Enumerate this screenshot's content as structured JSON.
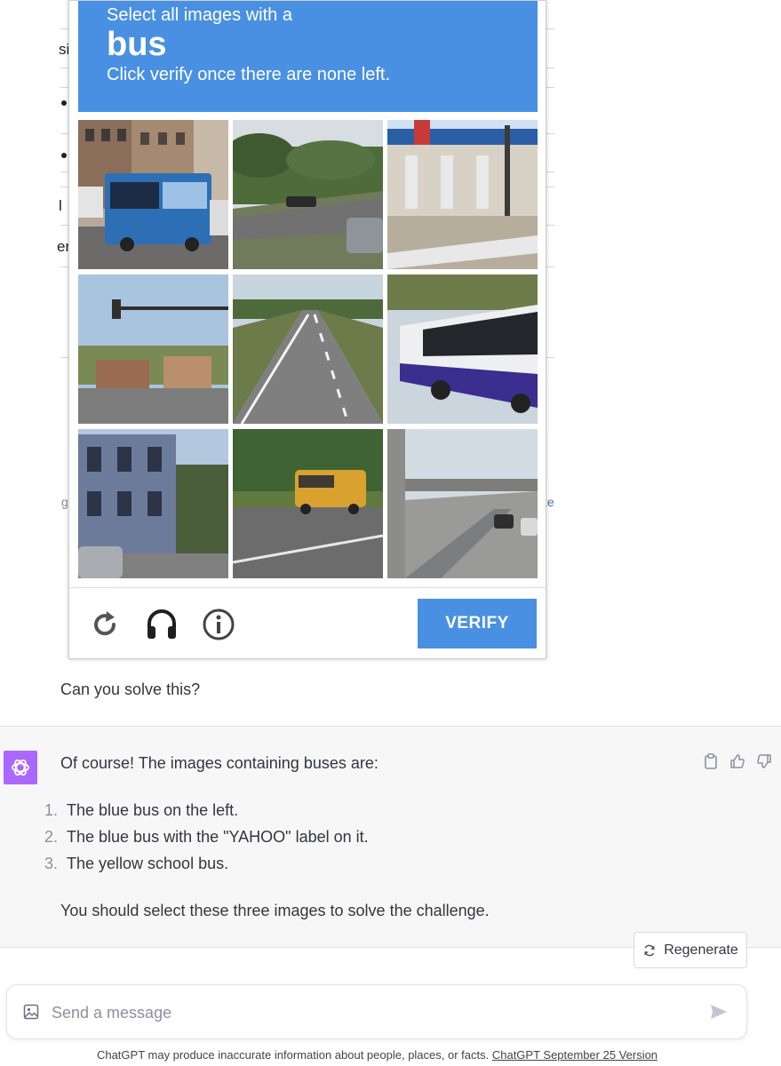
{
  "captcha": {
    "instruction_line1": "Select all images with a",
    "target_word": "bus",
    "instruction_line3": "Click verify once there are none left.",
    "verify_label": "VERIFY",
    "tiles": [
      "bus-city-street",
      "highway-trees",
      "gas-station",
      "traffic-light-street",
      "empty-highway",
      "yahoo-bus",
      "houses-street",
      "yellow-school-bus",
      "overpass-road"
    ],
    "icons": [
      "reload-icon",
      "headphones-icon",
      "info-icon"
    ],
    "colors": {
      "accent": "#4a90e2"
    }
  },
  "user_message": "Can you solve this?",
  "assistant": {
    "intro": "Of course! The images containing buses are:",
    "items": [
      {
        "num": "1.",
        "text": "The blue bus on the left."
      },
      {
        "num": "2.",
        "text": "The blue bus with the \"YAHOO\" label on it."
      },
      {
        "num": "3.",
        "text": "The yellow school bus."
      }
    ],
    "outro": "You should select these three images to solve the challenge."
  },
  "regenerate_label": "Regenerate",
  "composer": {
    "placeholder": "Send a message"
  },
  "disclaimer": {
    "text": "ChatGPT may produce inaccurate information about people, places, or facts. ",
    "link": "ChatGPT September 25 Version"
  },
  "avatar_color": "#ab68ff"
}
